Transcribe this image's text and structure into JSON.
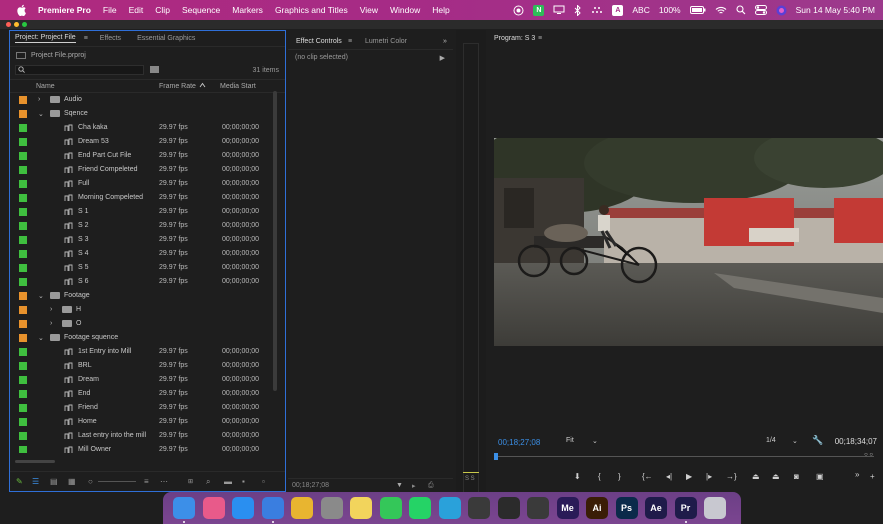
{
  "menubar": {
    "app_name": "Premiere Pro",
    "items": [
      "File",
      "Edit",
      "Clip",
      "Sequence",
      "Markers",
      "Graphics and Titles",
      "View",
      "Window",
      "Help"
    ],
    "input_source": "ABC",
    "input_badge": "A",
    "battery": "100%",
    "n_badge": "N",
    "datetime": "Sun 14 May  5:40 PM"
  },
  "project_panel": {
    "tabs": [
      "Project: Project File",
      "Effects",
      "Essential Graphics"
    ],
    "file_name": "Project File.prproj",
    "item_count": "31 items",
    "columns": {
      "name": "Name",
      "frame_rate": "Frame Rate",
      "media_start": "Media Start"
    },
    "rows": [
      {
        "kind": "folder",
        "level": 0,
        "chev": "›",
        "color": "#e8922c",
        "name": "Audio",
        "frame_rate": "",
        "media_start": ""
      },
      {
        "kind": "folder",
        "level": 0,
        "chev": "⌄",
        "color": "#e8922c",
        "name": "Sqence",
        "frame_rate": "",
        "media_start": ""
      },
      {
        "kind": "seq",
        "level": 1,
        "chev": "",
        "color": "#3fbf3f",
        "name": "Cha kaka",
        "frame_rate": "29.97 fps",
        "media_start": "00;00;00;00"
      },
      {
        "kind": "seq",
        "level": 1,
        "chev": "",
        "color": "#3fbf3f",
        "name": "Dream 53",
        "frame_rate": "29.97 fps",
        "media_start": "00;00;00;00"
      },
      {
        "kind": "seq",
        "level": 1,
        "chev": "",
        "color": "#3fbf3f",
        "name": "End Part Cut File",
        "frame_rate": "29.97 fps",
        "media_start": "00;00;00;00"
      },
      {
        "kind": "seq",
        "level": 1,
        "chev": "",
        "color": "#3fbf3f",
        "name": "Friend  Compeleted",
        "frame_rate": "29.97 fps",
        "media_start": "00;00;00;00"
      },
      {
        "kind": "seq",
        "level": 1,
        "chev": "",
        "color": "#3fbf3f",
        "name": "Full",
        "frame_rate": "29.97 fps",
        "media_start": "00;00;00;00"
      },
      {
        "kind": "seq",
        "level": 1,
        "chev": "",
        "color": "#3fbf3f",
        "name": "Morning Compeleted",
        "frame_rate": "29.97 fps",
        "media_start": "00;00;00;00"
      },
      {
        "kind": "seq",
        "level": 1,
        "chev": "",
        "color": "#3fbf3f",
        "name": "S 1",
        "frame_rate": "29.97 fps",
        "media_start": "00;00;00;00"
      },
      {
        "kind": "seq",
        "level": 1,
        "chev": "",
        "color": "#3fbf3f",
        "name": "S 2",
        "frame_rate": "29.97 fps",
        "media_start": "00;00;00;00"
      },
      {
        "kind": "seq",
        "level": 1,
        "chev": "",
        "color": "#3fbf3f",
        "name": "S 3",
        "frame_rate": "29.97 fps",
        "media_start": "00;00;00;00"
      },
      {
        "kind": "seq",
        "level": 1,
        "chev": "",
        "color": "#3fbf3f",
        "name": "S 4",
        "frame_rate": "29.97 fps",
        "media_start": "00;00;00;00"
      },
      {
        "kind": "seq",
        "level": 1,
        "chev": "",
        "color": "#3fbf3f",
        "name": "S 5",
        "frame_rate": "29.97 fps",
        "media_start": "00;00;00;00"
      },
      {
        "kind": "seq",
        "level": 1,
        "chev": "",
        "color": "#3fbf3f",
        "name": "S 6",
        "frame_rate": "29.97 fps",
        "media_start": "00;00;00;00"
      },
      {
        "kind": "folder",
        "level": 0,
        "chev": "⌄",
        "color": "#e8922c",
        "name": "Footage",
        "frame_rate": "",
        "media_start": ""
      },
      {
        "kind": "folder",
        "level": 1,
        "chev": "›",
        "color": "#e8922c",
        "name": "H",
        "frame_rate": "",
        "media_start": ""
      },
      {
        "kind": "folder",
        "level": 1,
        "chev": "›",
        "color": "#e8922c",
        "name": "O",
        "frame_rate": "",
        "media_start": ""
      },
      {
        "kind": "folder",
        "level": 0,
        "chev": "⌄",
        "color": "#e8922c",
        "name": "Footage squence",
        "frame_rate": "",
        "media_start": ""
      },
      {
        "kind": "seq",
        "level": 1,
        "chev": "",
        "color": "#3fbf3f",
        "name": "1st Entry into Mill",
        "frame_rate": "29.97 fps",
        "media_start": "00;00;00;00"
      },
      {
        "kind": "seq",
        "level": 1,
        "chev": "",
        "color": "#3fbf3f",
        "name": "BRL",
        "frame_rate": "29.97 fps",
        "media_start": "00;00;00;00"
      },
      {
        "kind": "seq",
        "level": 1,
        "chev": "",
        "color": "#3fbf3f",
        "name": "Dream",
        "frame_rate": "29.97 fps",
        "media_start": "00;00;00;00"
      },
      {
        "kind": "seq",
        "level": 1,
        "chev": "",
        "color": "#3fbf3f",
        "name": "End",
        "frame_rate": "29.97 fps",
        "media_start": "00;00;00;00"
      },
      {
        "kind": "seq",
        "level": 1,
        "chev": "",
        "color": "#3fbf3f",
        "name": "Friend",
        "frame_rate": "29.97 fps",
        "media_start": "00;00;00;00"
      },
      {
        "kind": "seq",
        "level": 1,
        "chev": "",
        "color": "#3fbf3f",
        "name": "Home",
        "frame_rate": "29.97 fps",
        "media_start": "00;00;00;00"
      },
      {
        "kind": "seq",
        "level": 1,
        "chev": "",
        "color": "#3fbf3f",
        "name": "Last entry into the mill",
        "frame_rate": "29.97 fps",
        "media_start": "00;00;00;00"
      },
      {
        "kind": "seq",
        "level": 1,
        "chev": "",
        "color": "#3fbf3f",
        "name": "Mill Owner",
        "frame_rate": "29.97 fps",
        "media_start": "00;00;00;00"
      }
    ]
  },
  "effect_controls": {
    "tabs": [
      "Effect Controls",
      "Lumetri Color"
    ],
    "overflow": "»",
    "clip_status": "(no clip selected)",
    "footer_timecode": "00;18;27;08"
  },
  "meter": {
    "label": "S S"
  },
  "program_monitor": {
    "title": "Program: S 3",
    "timecode_current": "00;18;27;08",
    "zoom": "Fit",
    "resolution": "1/4",
    "timecode_duration": "00;18;34;07",
    "overflow": "»"
  },
  "dock": {
    "apps": [
      {
        "name": "finder-icon",
        "color": "#3c8fe8",
        "label": ""
      },
      {
        "name": "launchpad-icon",
        "color": "#e85a8a",
        "label": ""
      },
      {
        "name": "app-store-icon",
        "color": "#2a8ff0",
        "label": ""
      },
      {
        "name": "safari-icon",
        "color": "#3a7ee0",
        "label": ""
      },
      {
        "name": "chrome-icon",
        "color": "#e8b530",
        "label": ""
      },
      {
        "name": "system-settings-icon",
        "color": "#8a8a8a",
        "label": ""
      },
      {
        "name": "notes-icon",
        "color": "#f2d45c",
        "label": ""
      },
      {
        "name": "messages-icon",
        "color": "#34c759",
        "label": ""
      },
      {
        "name": "whatsapp-icon",
        "color": "#25d366",
        "label": ""
      },
      {
        "name": "telegram-icon",
        "color": "#2aa1da",
        "label": ""
      },
      {
        "name": "chatgpt-icon",
        "color": "#3a3a3a",
        "label": ""
      },
      {
        "name": "davinci-icon",
        "color": "#2b2b2b",
        "label": ""
      },
      {
        "name": "final-cut-icon",
        "color": "#3a3a3a",
        "label": ""
      },
      {
        "name": "media-encoder-icon",
        "color": "#2a1b58",
        "label": "Me"
      },
      {
        "name": "illustrator-icon",
        "color": "#3a1d06",
        "label": "Ai"
      },
      {
        "name": "photoshop-icon",
        "color": "#0b2a4a",
        "label": "Ps"
      },
      {
        "name": "after-effects-icon",
        "color": "#1f1b4a",
        "label": "Ae"
      },
      {
        "name": "premiere-icon",
        "color": "#1f1b4a",
        "label": "Pr"
      },
      {
        "name": "trash-icon",
        "color": "#c8c8d0",
        "label": ""
      }
    ]
  },
  "colors": {
    "accent_blue": "#3b8fe6",
    "label_orange": "#e8922c",
    "label_green": "#3fbf3f",
    "panel_bg": "#1e1e1e",
    "menubar": "#a62b86"
  }
}
